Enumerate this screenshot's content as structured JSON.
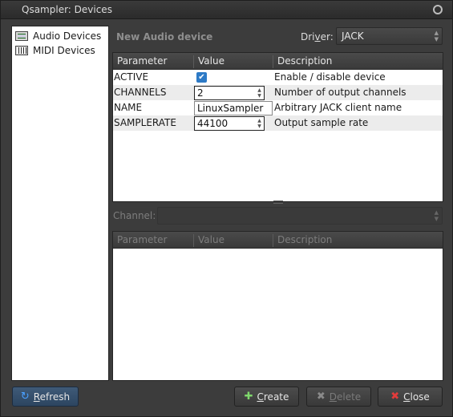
{
  "window": {
    "title": "Qsampler: Devices"
  },
  "tree": {
    "items": [
      {
        "label": "Audio Devices",
        "icon": "audio-device-icon"
      },
      {
        "label": "MIDI Devices",
        "icon": "midi-device-icon"
      }
    ]
  },
  "header": {
    "new_device_label": "New Audio device",
    "driver_label_pre": "Dri",
    "driver_label_accel": "v",
    "driver_label_post": "er:",
    "driver_value": "JACK"
  },
  "params_table": {
    "columns": [
      "Parameter",
      "Value",
      "Description"
    ],
    "rows": [
      {
        "parameter": "ACTIVE",
        "value": "",
        "checked": true,
        "description": "Enable / disable device"
      },
      {
        "parameter": "CHANNELS",
        "value": "2",
        "description": "Number of output channels"
      },
      {
        "parameter": "NAME",
        "value": "LinuxSampler",
        "description": "Arbitrary JACK client name"
      },
      {
        "parameter": "SAMPLERATE",
        "value": "44100",
        "description": "Output sample rate"
      }
    ]
  },
  "channel": {
    "label": "Channel:",
    "value": ""
  },
  "port_table": {
    "columns": [
      "Parameter",
      "Value",
      "Description"
    ]
  },
  "buttons": {
    "refresh": {
      "accel": "R",
      "rest": "efresh"
    },
    "create": {
      "accel": "C",
      "rest": "reate"
    },
    "delete": {
      "accel": "D",
      "rest": "elete"
    },
    "close": {
      "accel": "C",
      "rest": "lose"
    }
  }
}
